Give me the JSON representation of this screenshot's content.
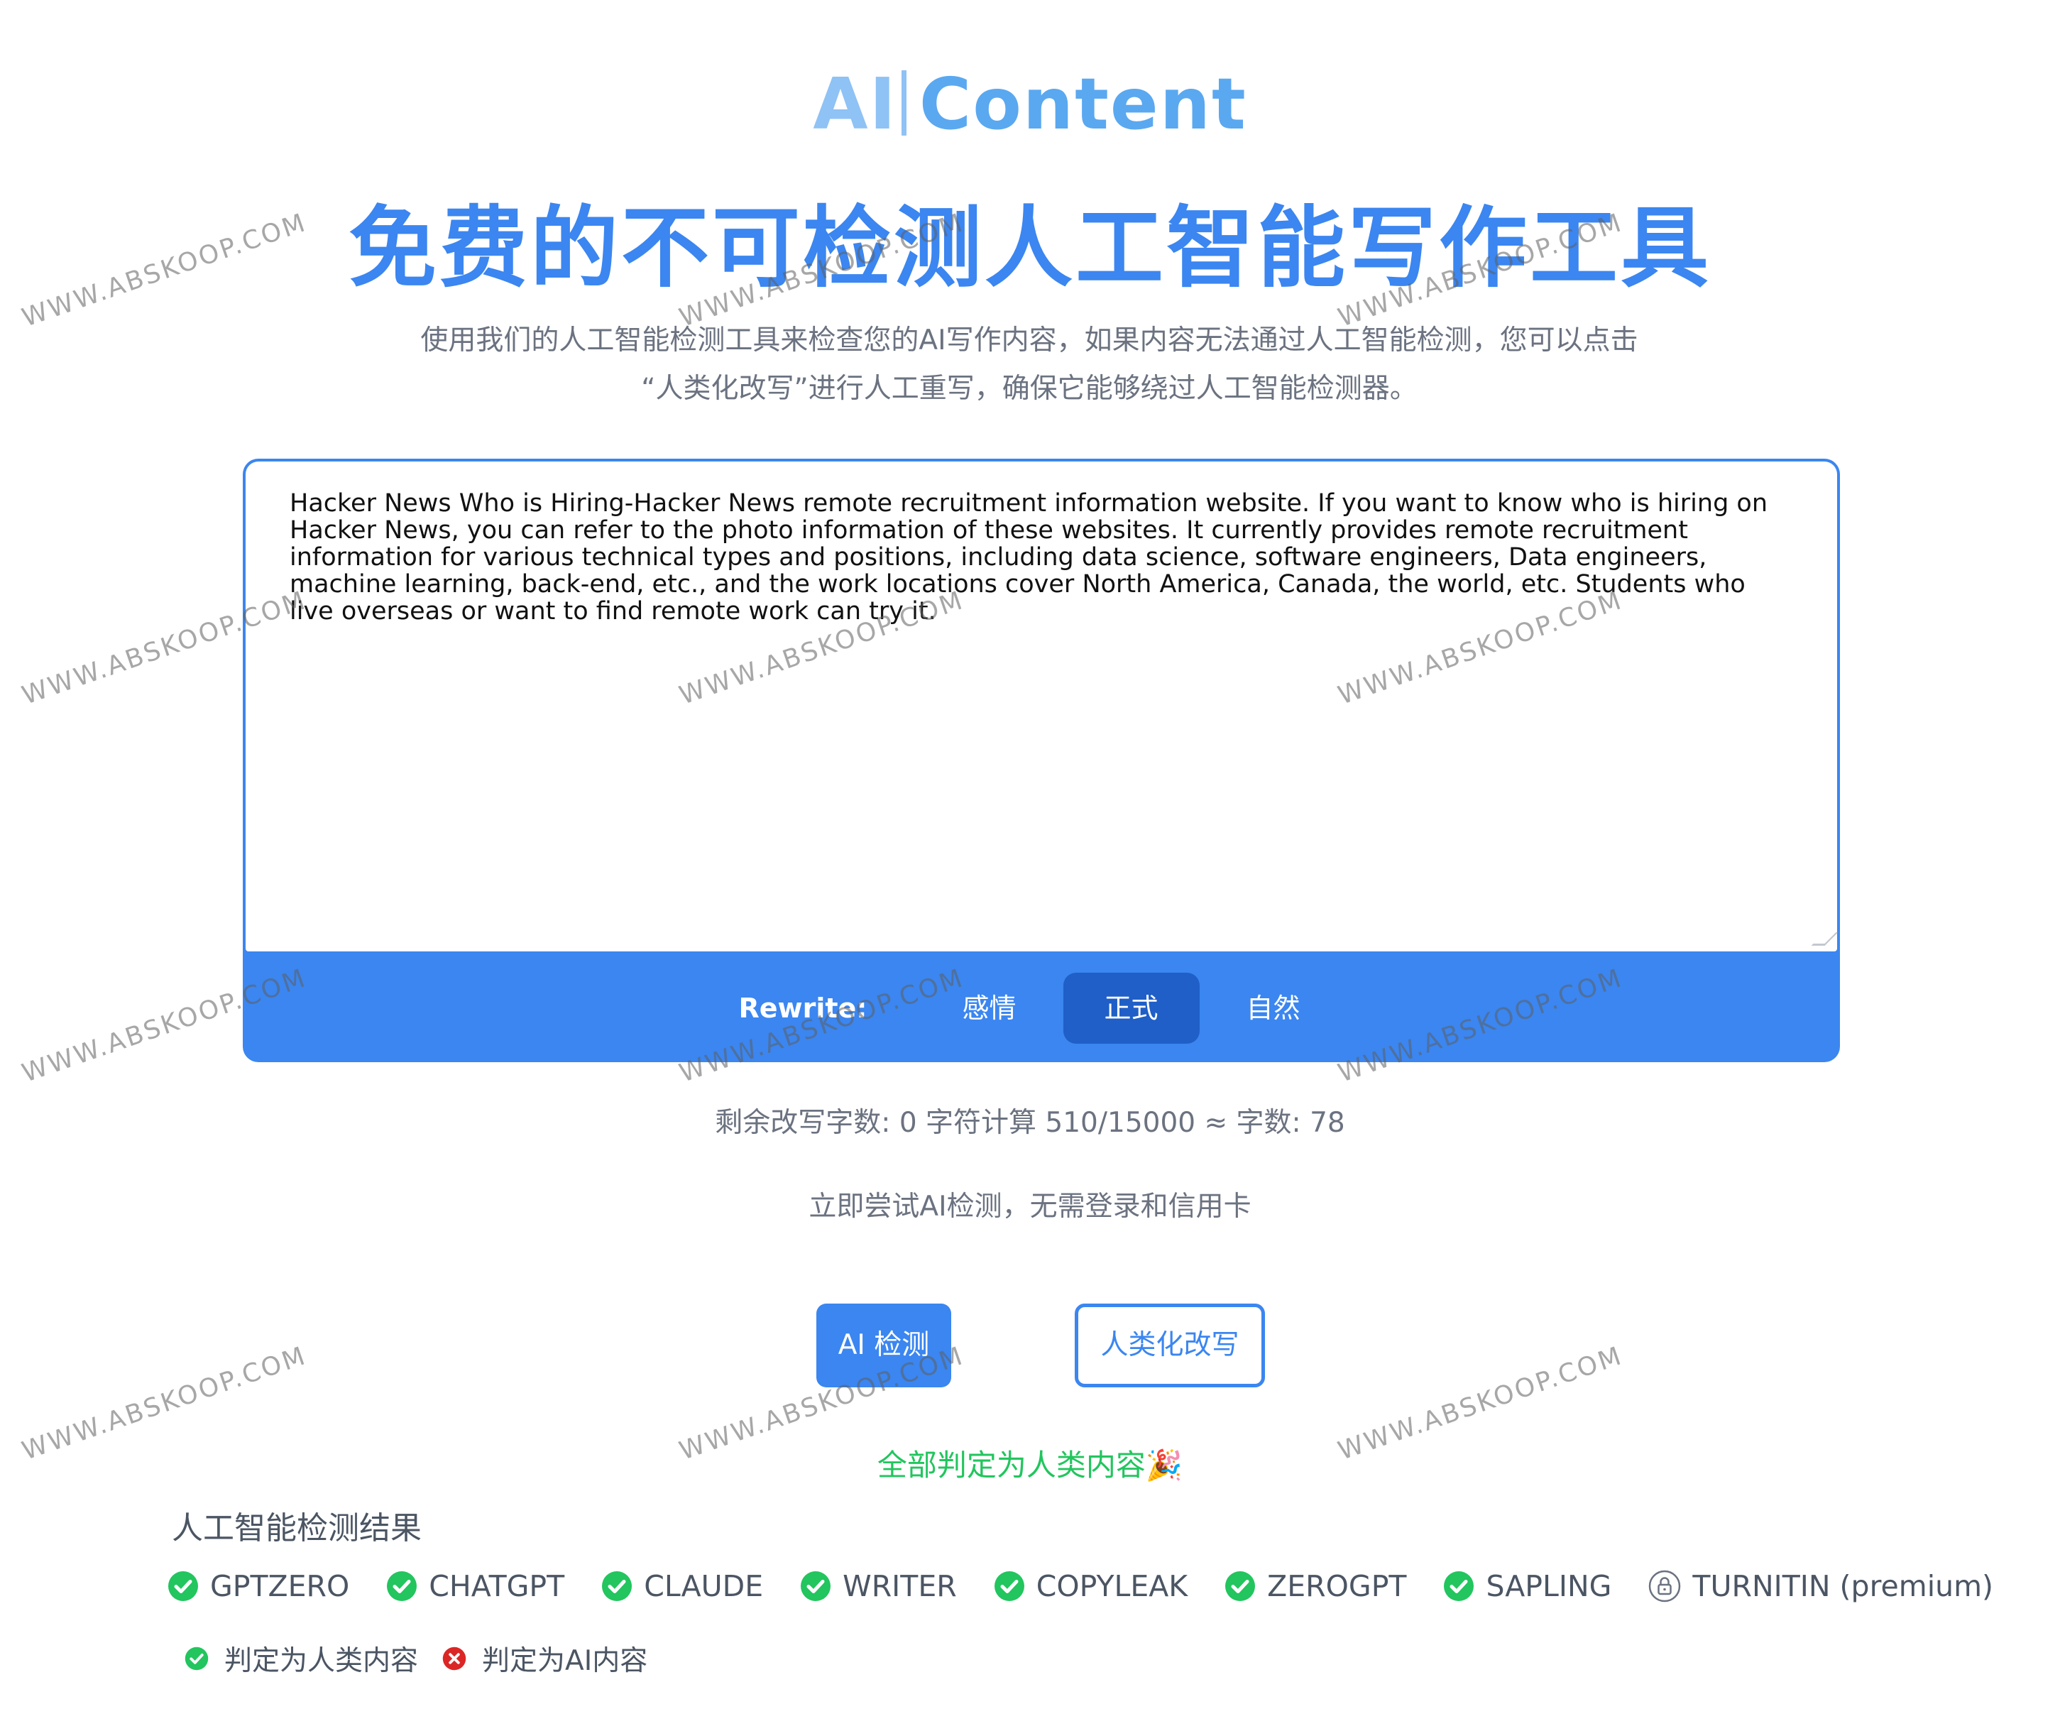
{
  "brand": {
    "ai": "AI",
    "content": "Content"
  },
  "headline": "免费的不可检测人工智能写作工具",
  "subtitle": {
    "line1": "使用我们的人工智能检测工具来检查您的AI写作内容，如果内容无法通过人工智能检测，您可以点击",
    "line2": "“人类化改写”进行人工重写，确保它能够绕过人工智能检测器。"
  },
  "editor": {
    "text": "Hacker News Who is Hiring-Hacker News remote recruitment information website. If you want to know who is hiring on Hacker News, you can refer to the photo information of these websites. It currently provides remote recruitment information for various technical types and positions, including data science, software engineers, Data engineers, machine learning, back-end, etc., and the work locations cover North America, Canada, the world, etc. Students who live overseas or want to find remote work can try it."
  },
  "rewrite": {
    "label": "Rewrite:",
    "modes": [
      "感情",
      "正式",
      "自然"
    ],
    "active": "正式"
  },
  "counter": "剩余改写字数: 0  字符计算 510/15000 ≈ 字数: 78",
  "try_note": "立即尝试AI检测，无需登录和信用卡",
  "buttons": {
    "detect": "AI 检测",
    "humanize": "人类化改写"
  },
  "verdict": "全部判定为人类内容🎉",
  "results": {
    "title": "人工智能检测结果",
    "detectors": [
      {
        "name": "GPTZERO",
        "status": "human"
      },
      {
        "name": "CHATGPT",
        "status": "human"
      },
      {
        "name": "CLAUDE",
        "status": "human"
      },
      {
        "name": "WRITER",
        "status": "human"
      },
      {
        "name": "COPYLEAK",
        "status": "human"
      },
      {
        "name": "ZEROGPT",
        "status": "human"
      },
      {
        "name": "SAPLING",
        "status": "human"
      },
      {
        "name": "TURNITIN (premium)",
        "status": "locked"
      }
    ],
    "legend": {
      "human": "判定为人类内容",
      "ai": "判定为AI内容"
    }
  },
  "watermark": "WWW.ABSKOOP.COM",
  "colors": {
    "primary": "#3b86f0",
    "active_mode": "#1f5fc7",
    "success": "#22c55e",
    "error": "#dc2626",
    "brand_light": "#8fc2f5"
  }
}
